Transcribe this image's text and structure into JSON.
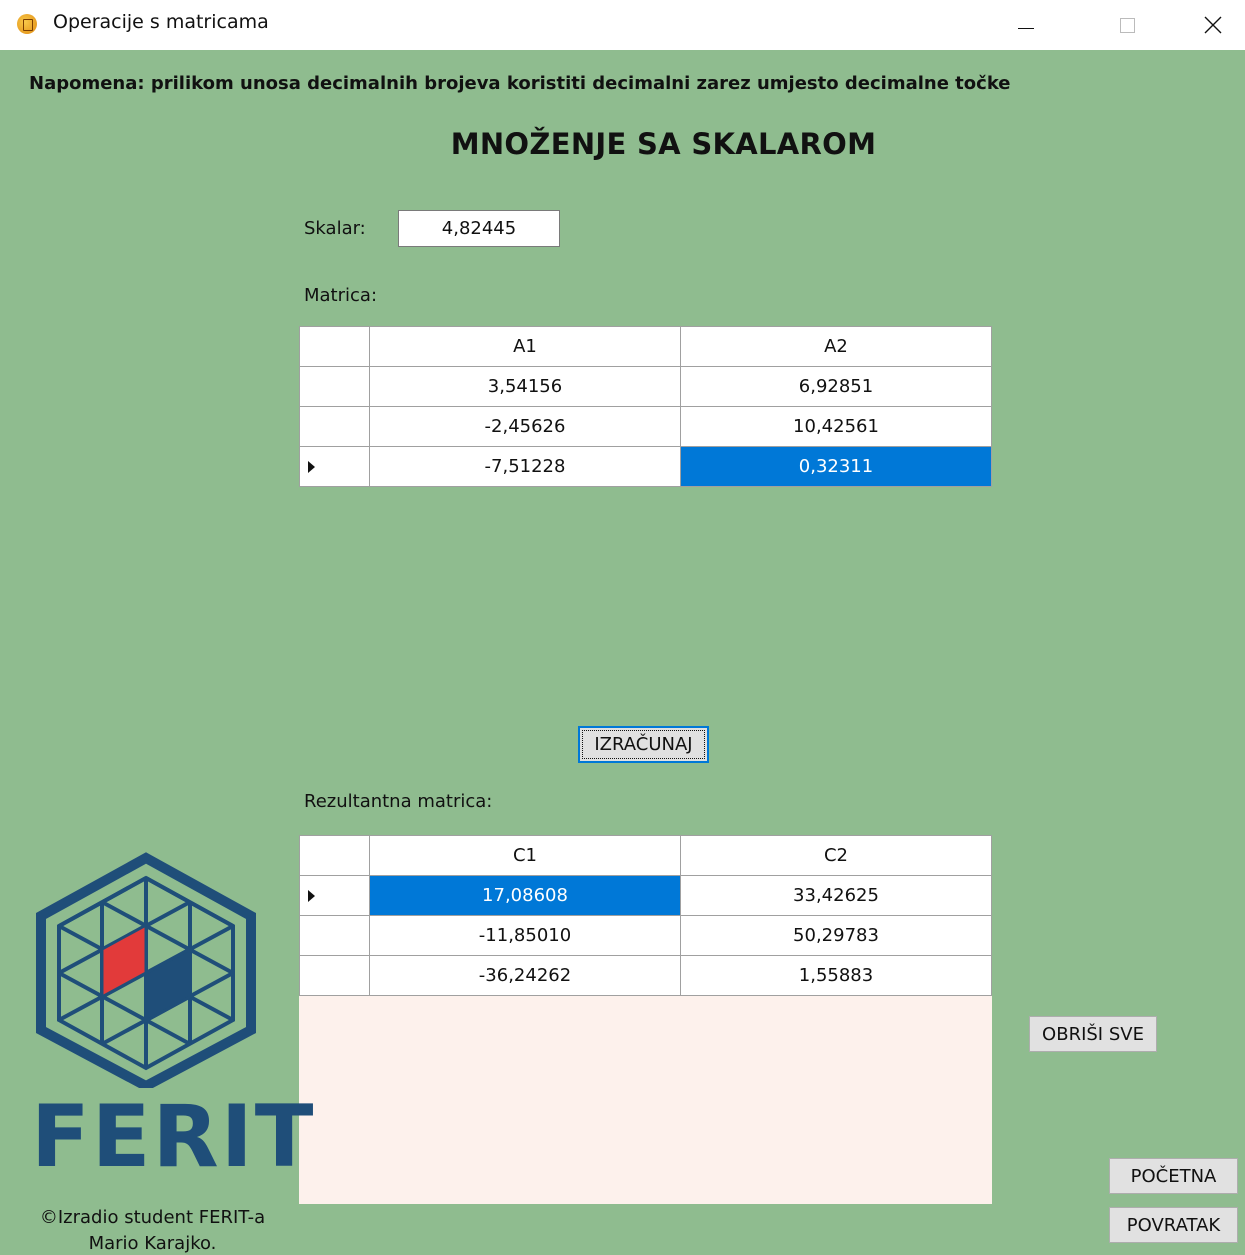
{
  "window": {
    "title": "Operacije s matricama",
    "controls": {
      "minimize": "minimize-icon",
      "maximize": "maximize-icon",
      "close": "close-icon"
    }
  },
  "note": "Napomena: prilikom unosa decimalnih brojeva koristiti decimalni zarez umjesto decimalne točke",
  "heading": "MNOŽENJE SA SKALAROM",
  "scalar": {
    "label": "Skalar:",
    "value": "4,82445"
  },
  "matrix": {
    "label": "Matrica:",
    "columns": [
      "A1",
      "A2"
    ],
    "rows": [
      [
        "3,54156",
        "6,92851"
      ],
      [
        "-2,45626",
        "10,42561"
      ],
      [
        "-7,51228",
        "0,32311"
      ]
    ],
    "current_row": 2,
    "selected_cell": [
      2,
      1
    ]
  },
  "calculate_label": "IZRAČUNAJ",
  "result": {
    "label": "Rezultantna matrica:",
    "columns": [
      "C1",
      "C2"
    ],
    "rows": [
      [
        "17,08608",
        "33,42625"
      ],
      [
        "-11,85010",
        "50,29783"
      ],
      [
        "-36,24262",
        "1,55883"
      ]
    ],
    "current_row": 0,
    "selected_cell": [
      0,
      0
    ]
  },
  "buttons": {
    "clear_all": "OBRIŠI SVE",
    "home": "POČETNA",
    "back": "POVRATAK"
  },
  "logo": {
    "text": "FERIT",
    "colors": {
      "primary": "#1f4e79",
      "accent_red": "#e23a3a",
      "accent_navy": "#1f4e79"
    }
  },
  "credit": {
    "line1": "©Izradio student FERIT-a",
    "line2": "Mario Karajko."
  },
  "colors": {
    "background": "#8fbc8f",
    "selection": "#0078d7",
    "result_area": "#fdf1ec"
  }
}
